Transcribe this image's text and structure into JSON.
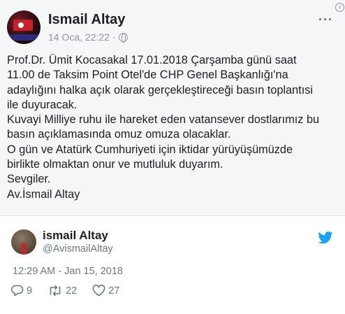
{
  "facebook_post": {
    "author": "Ismail Altay",
    "timestamp": "14 Oca, 22:22",
    "separator": "·",
    "more_label": "···",
    "info_label": "i",
    "body_lines": [
      "Prof.Dr. Ümit  Kocasakal  17.01.2018 Çarşamba günü saat",
      "11.00 de Taksim Point Otel'de CHP Genel Başkanlığı'na",
      "adaylığını halka açık olarak gerçekleştireceği basın toplantısi",
      "ile duyuracak.",
      "Kuvayi Milliye ruhu ile hareket eden vatansever dostlarımız bu",
      "basın açıklamasında omuz omuza olacaklar.",
      "O gün ve Atatürk Cumhuriyeti için iktidar yürüyüşümüzde",
      "birlikte olmaktan onur ve mutluluk duyarım.",
      "Sevgiler.",
      "Av.İsmail Altay"
    ]
  },
  "tweet": {
    "name": "ismail Altay",
    "handle": "@AvismailAltay",
    "time": "12:29 AM - Jan 15, 2018",
    "replies": "9",
    "retweets": "22",
    "likes": "27",
    "brand_color": "#1da1f2"
  }
}
